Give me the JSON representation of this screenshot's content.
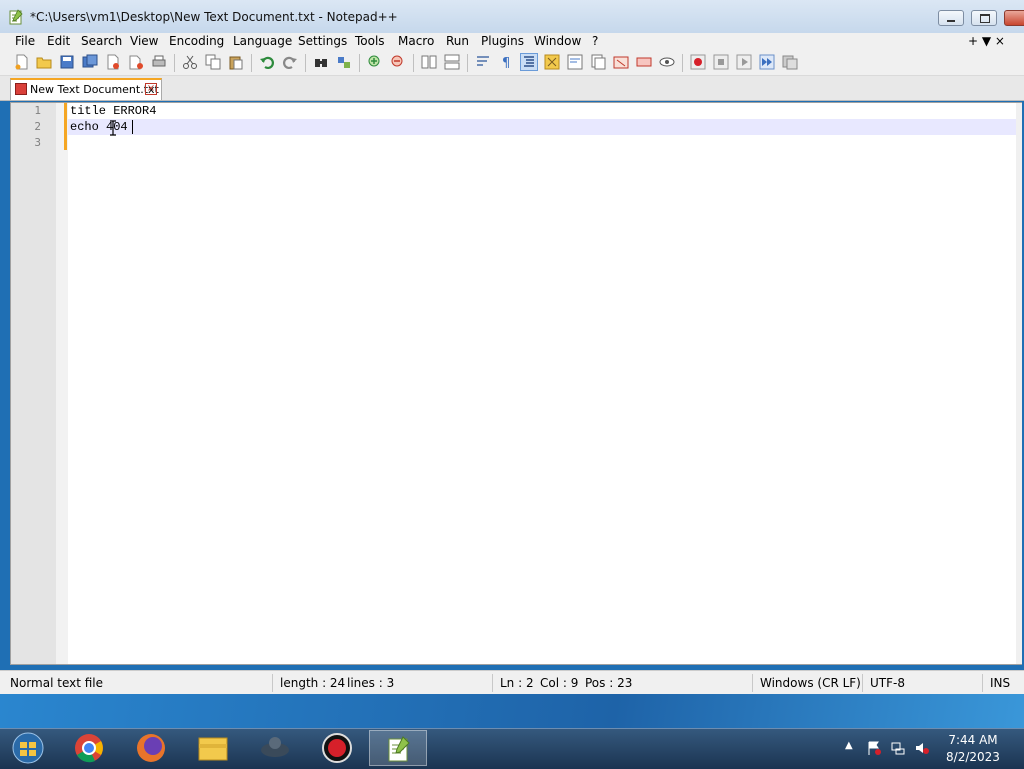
{
  "window": {
    "title": "*C:\\Users\\vm1\\Desktop\\New Text Document.txt - Notepad++"
  },
  "menu": {
    "items": [
      "File",
      "Edit",
      "Search",
      "View",
      "Encoding",
      "Language",
      "Settings",
      "Tools",
      "Macro",
      "Run",
      "Plugins",
      "Window",
      "?"
    ],
    "right": "+ ▼ ×"
  },
  "tab": {
    "label": "New Text Document.txt",
    "close": "×"
  },
  "editor": {
    "line_numbers": [
      "1",
      "2",
      "3"
    ],
    "lines": [
      "title ERROR4",
      "echo 404",
      ""
    ]
  },
  "status": {
    "file_type": "Normal text file",
    "length": "length : 24",
    "lines": "lines : 3",
    "ln": "Ln : 2",
    "col": "Col : 9",
    "pos": "Pos : 23",
    "eol": "Windows (CR LF)",
    "encoding": "UTF-8",
    "mode": "INS"
  },
  "taskbar": {
    "time": "7:44 AM",
    "date": "8/2/2023",
    "apps": [
      "start-orb-icon",
      "chrome-icon",
      "firefox-icon",
      "file-explorer-icon",
      "app-icon",
      "recorder-icon",
      "notepadpp-icon"
    ]
  }
}
